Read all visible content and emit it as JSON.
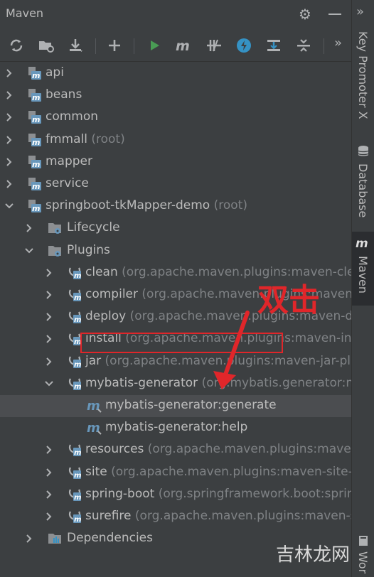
{
  "panel": {
    "title": "Maven"
  },
  "toolbar": {
    "buttons": [
      {
        "name": "reload-all-icon"
      },
      {
        "name": "generate-sources-icon"
      },
      {
        "name": "download-sources-icon"
      },
      {
        "name": "add-maven-project-icon"
      },
      {
        "name": "run-icon"
      },
      {
        "name": "execute-goal-icon"
      },
      {
        "name": "toggle-offline-icon"
      },
      {
        "name": "skip-tests-icon"
      },
      {
        "name": "show-dependencies-icon"
      },
      {
        "name": "collapse-all-icon"
      }
    ],
    "more": "»"
  },
  "tree": {
    "projects": [
      {
        "label": "api"
      },
      {
        "label": "beans"
      },
      {
        "label": "common"
      },
      {
        "label": "fmmall",
        "hint": "(root)"
      },
      {
        "label": "mapper"
      },
      {
        "label": "service"
      },
      {
        "label": "springboot-tkMapper-demo",
        "hint": "(root)"
      }
    ],
    "lifecycle": "Lifecycle",
    "plugins_label": "Plugins",
    "plugins": [
      {
        "label": "clean",
        "hint": "(org.apache.maven.plugins:maven-clean"
      },
      {
        "label": "compiler",
        "hint": "(org.apache.maven.plugins:maven-co"
      },
      {
        "label": "deploy",
        "hint": "(org.apache.maven.plugins:maven-dep"
      },
      {
        "label": "install",
        "hint": "(org.apache.maven.plugins:maven-insta"
      },
      {
        "label": "jar",
        "hint": "(org.apache.maven.plugins:maven-jar-plug"
      },
      {
        "label": "mybatis-generator",
        "hint": "(org.mybatis.generator:myb"
      }
    ],
    "goals": [
      {
        "label": "mybatis-generator:generate"
      },
      {
        "label": "mybatis-generator:help"
      }
    ],
    "plugins_after": [
      {
        "label": "resources",
        "hint": "(org.apache.maven.plugins:maven-r"
      },
      {
        "label": "site",
        "hint": "(org.apache.maven.plugins:maven-site-plu"
      },
      {
        "label": "spring-boot",
        "hint": "(org.springframework.boot:spring"
      },
      {
        "label": "surefire",
        "hint": "(org.apache.maven.plugins:maven-sur"
      }
    ],
    "dependencies": "Dependencies"
  },
  "annotation": {
    "text": "双击"
  },
  "right_strip": {
    "tabs": [
      {
        "label": "Key Promoter X"
      },
      {
        "label": "Database"
      },
      {
        "label": "Maven",
        "active": true
      },
      {
        "label": "Wor"
      }
    ],
    "more": "»"
  },
  "watermark": {
    "text": "吉林龙网"
  },
  "colors": {
    "background": "#3c3f41",
    "text": "#bbbbbb",
    "hint": "#7f8285",
    "selection": "#4b4d50",
    "annotation": "#e0262a",
    "maven_icon": "#6897bb",
    "run_green": "#499c54"
  }
}
